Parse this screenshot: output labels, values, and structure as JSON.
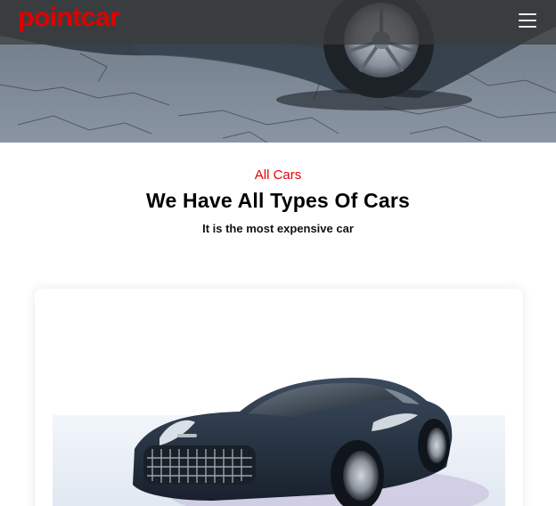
{
  "header": {
    "logo": "pointcar",
    "menu_icon": "hamburger-icon"
  },
  "hero": {
    "image": "car-wheel-on-cracked-pavement"
  },
  "section": {
    "eyebrow": "All Cars",
    "title": "We Have All Types Of Cars",
    "subtitle": "It is the most expensive car"
  },
  "card": {
    "image": "dark-blue-sports-car"
  },
  "colors": {
    "brand": "#e00000",
    "eyebrow": "#e60000",
    "navbar": "#3c3c3c"
  }
}
